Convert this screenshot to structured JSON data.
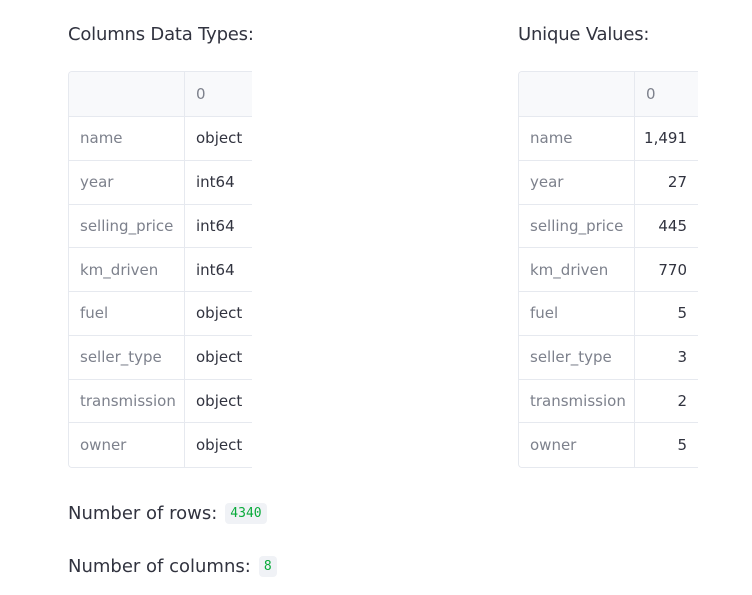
{
  "dtypes": {
    "heading": "Columns Data Types:",
    "column_header": "0",
    "rows": [
      {
        "label": "name",
        "value": "object"
      },
      {
        "label": "year",
        "value": "int64"
      },
      {
        "label": "selling_price",
        "value": "int64"
      },
      {
        "label": "km_driven",
        "value": "int64"
      },
      {
        "label": "fuel",
        "value": "object"
      },
      {
        "label": "seller_type",
        "value": "object"
      },
      {
        "label": "transmission",
        "value": "object"
      },
      {
        "label": "owner",
        "value": "object"
      }
    ]
  },
  "unique": {
    "heading": "Unique Values:",
    "column_header": "0",
    "rows": [
      {
        "label": "name",
        "value": "1,491"
      },
      {
        "label": "year",
        "value": "27"
      },
      {
        "label": "selling_price",
        "value": "445"
      },
      {
        "label": "km_driven",
        "value": "770"
      },
      {
        "label": "fuel",
        "value": "5"
      },
      {
        "label": "seller_type",
        "value": "3"
      },
      {
        "label": "transmission",
        "value": "2"
      },
      {
        "label": "owner",
        "value": "5"
      }
    ]
  },
  "stats": {
    "rows_label": "Number of rows:",
    "rows_value": "4340",
    "cols_label": "Number of columns:",
    "cols_value": "8"
  },
  "colors": {
    "code_text": "#09ab3b",
    "code_bg": "#f0f2f6",
    "border": "#e6e9ef"
  }
}
